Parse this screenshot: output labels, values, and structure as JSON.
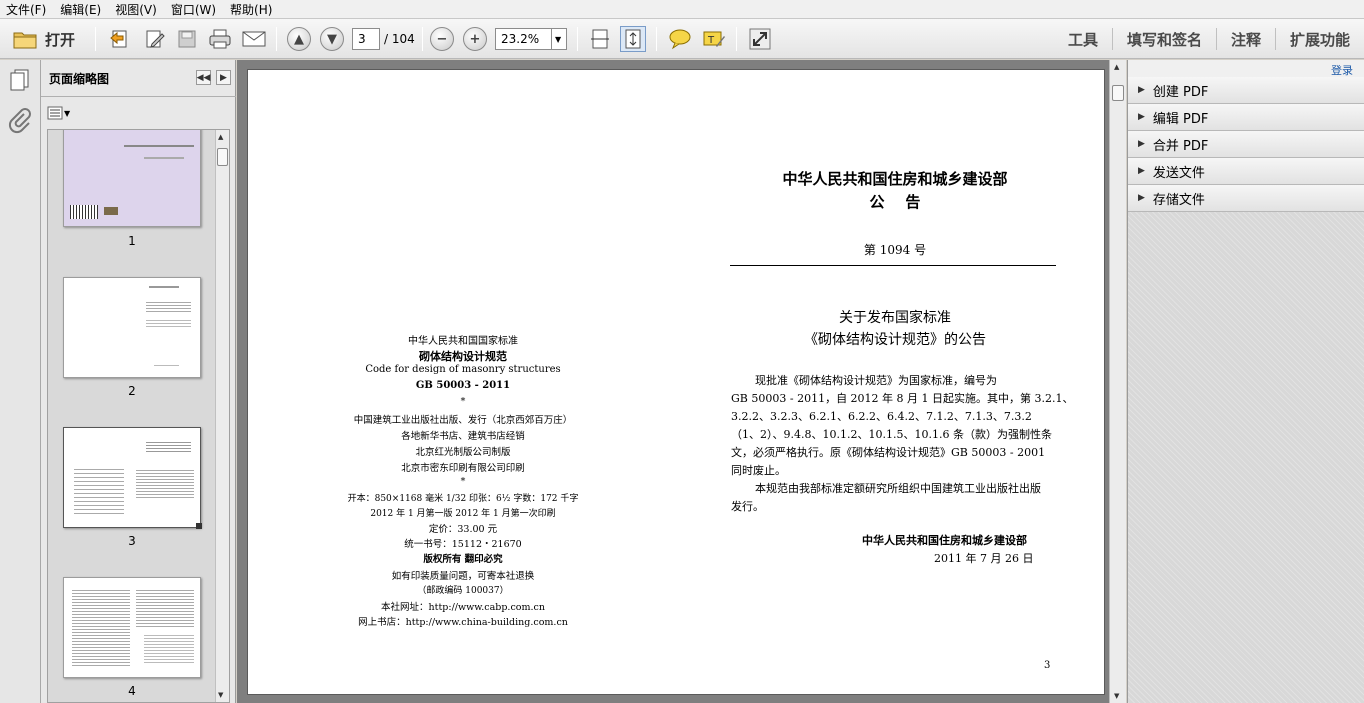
{
  "menubar": [
    "文件(F)",
    "编辑(E)",
    "视图(V)",
    "窗口(W)",
    "帮助(H)"
  ],
  "toolbar": {
    "open_label": "打开",
    "page_current": "3",
    "page_total": "/ 104",
    "zoom": "23.2%",
    "right_links": [
      "工具",
      "填写和签名",
      "注释",
      "扩展功能"
    ]
  },
  "thumbnails": {
    "title": "页面缩略图",
    "pages": [
      "1",
      "2",
      "3",
      "4"
    ]
  },
  "tasks": {
    "signin": "登录",
    "items": [
      "创建 PDF",
      "编辑 PDF",
      "合并 PDF",
      "发送文件",
      "存储文件"
    ]
  },
  "page": {
    "left": {
      "line1": "中华人民共和国国家标准",
      "line2": "砌体结构设计规范",
      "line3": "Code for design of masonry structures",
      "line4": "GB 50003 - 2011",
      "star1": "*",
      "line5": "中国建筑工业出版社出版、发行（北京西郊百万庄）",
      "line6": "各地新华书店、建筑书店经销",
      "line7": "北京红光制版公司制版",
      "line8": "北京市密东印刷有限公司印刷",
      "star2": "*",
      "line9": "开本：850×1168 毫米  1/32  印张：6½  字数：172 千字",
      "line10": "2012 年 1 月第一版    2012 年 1 月第一次印刷",
      "line11": "定价：33.00 元",
      "line12": "统一书号：15112・21670",
      "line13": "版权所有  翻印必究",
      "line14": "如有印装质量问题，可寄本社退换",
      "line15": "（邮政编码 100037）",
      "line16": "本社网址：http://www.cabp.com.cn",
      "line17": "网上书店：http://www.china-building.com.cn"
    },
    "right": {
      "ministry": "中华人民共和国住房和城乡建设部",
      "notice": "公    告",
      "number": "第 1094 号",
      "subject1": "关于发布国家标准",
      "subject2": "《砌体结构设计规范》的公告",
      "body1": "现批准《砌体结构设计规范》为国家标准，编号为",
      "body2": "GB 50003 - 2011，自 2012 年 8 月 1 日起实施。其中，第 3.2.1、",
      "body3": "3.2.2、3.2.3、6.2.1、6.2.2、6.4.2、7.1.2、7.1.3、7.3.2",
      "body4": "（1、2）、9.4.8、10.1.2、10.1.5、10.1.6 条（款）为强制性条",
      "body5": "文，必须严格执行。原《砌体结构设计规范》GB 50003 - 2001",
      "body6": "同时废止。",
      "body7": "本规范由我部标准定额研究所组织中国建筑工业出版社出版",
      "body8": "发行。",
      "sign": "中华人民共和国住房和城乡建设部",
      "date": "2011 年 7 月 26 日",
      "pagenum": "3"
    }
  }
}
